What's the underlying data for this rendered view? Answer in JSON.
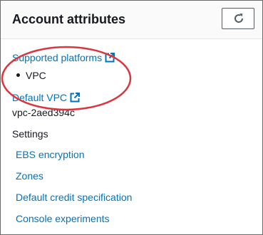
{
  "panel": {
    "title": "Account attributes",
    "refresh_icon": "refresh-icon"
  },
  "supported_platforms": {
    "label": "Supported platforms",
    "icon": "external-link-icon",
    "items": [
      "VPC"
    ]
  },
  "default_vpc": {
    "label": "Default VPC",
    "icon": "external-link-icon",
    "value": "vpc-2aed394c"
  },
  "settings": {
    "heading": "Settings",
    "links": [
      "EBS encryption",
      "Zones",
      "Default credit specification",
      "Console experiments"
    ]
  },
  "colors": {
    "link": "#0073bb",
    "annotation": "#d9363e",
    "text": "#16191f"
  }
}
